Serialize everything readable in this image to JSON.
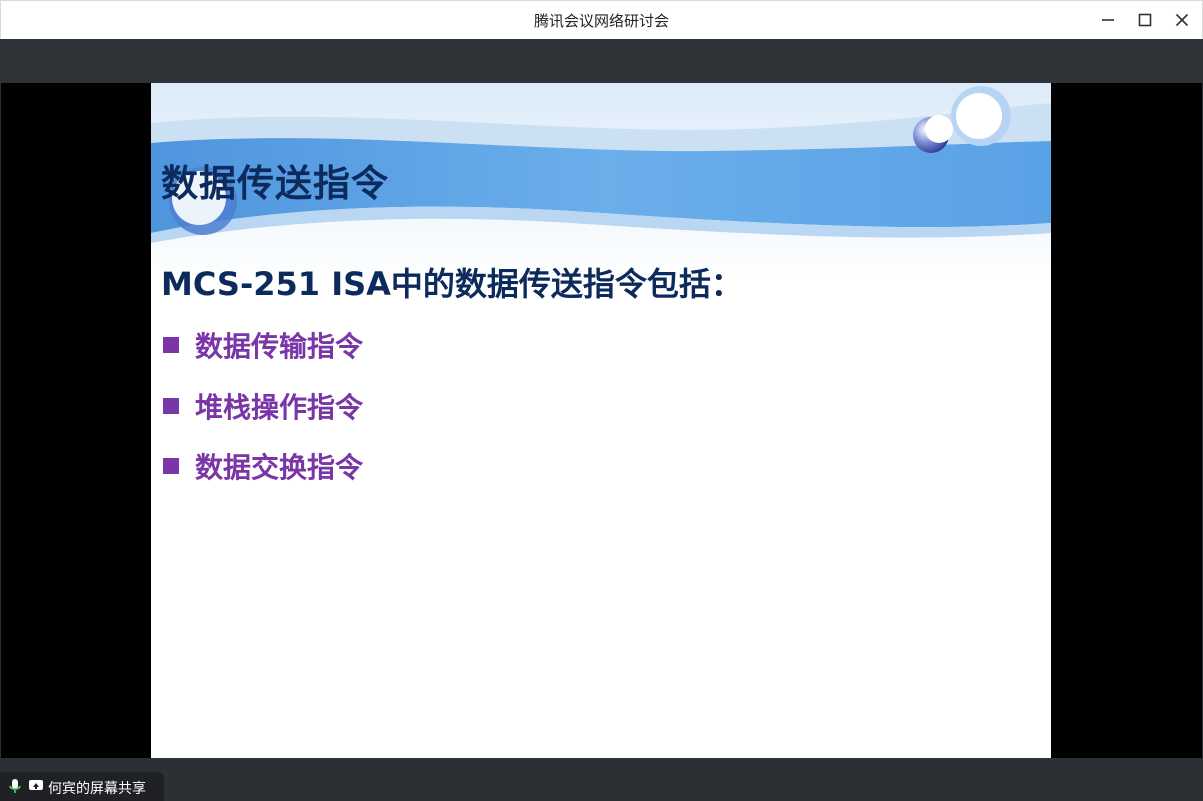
{
  "window": {
    "title": "腾讯会议网络研讨会",
    "controls": [
      "minimize-icon",
      "maximize-icon",
      "close-icon"
    ]
  },
  "slide": {
    "title": "数据传送指令",
    "subtitle": "MCS-251 ISA中的数据传送指令包括：",
    "bullets": [
      "数据传输指令",
      "堆栈操作指令",
      "数据交换指令"
    ],
    "colors": {
      "title": "#0d2a5c",
      "bullet": "#7a35a6",
      "banner": "#5fa7e8"
    }
  },
  "share_status": {
    "label": "何宾的屏幕共享",
    "icons": [
      "microphone-icon",
      "screen-share-icon"
    ]
  }
}
